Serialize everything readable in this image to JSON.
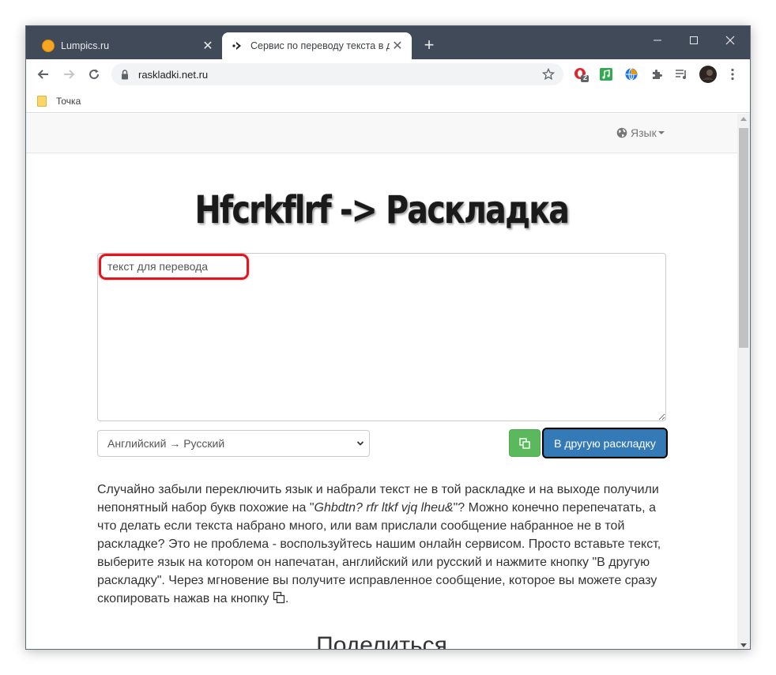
{
  "browser": {
    "tabs": [
      {
        "title": "Lumpics.ru",
        "active": false,
        "favicon": "orange-circle-icon"
      },
      {
        "title": "Сервис по переводу текста в др",
        "active": true,
        "favicon": "arrow-logo-icon"
      }
    ],
    "new_tab_label": "+",
    "address": {
      "url": "raskladki.net.ru"
    },
    "extension_badge": "2",
    "bookmarks": [
      {
        "label": "Точка",
        "icon": "folder-icon"
      }
    ]
  },
  "page": {
    "nav": {
      "language_label": "Язык"
    },
    "title": "Hfcrkflrf -> Раскладка",
    "textarea": {
      "value": "текст для перевода"
    },
    "direction_select": {
      "selected": "Английский → Русский"
    },
    "convert_button": "В другую раскладку",
    "description": {
      "p1": "Случайно забыли переключить язык и набрали текст не в той раскладке и на выходе получили непонятный набор букв похожие на \"",
      "example": "Ghbdtn? rfr ltkf vjq lheu&",
      "p2": "\"? Можно конечно перепечатать, а что делать если текста набрано много, или вам прислали сообщение набранное не в той раскладке? Это не проблема - воспользуйтесь нашим онлайн сервисом. Просто вставьте текст, выберите язык на котором он напечатан, английский или русский и нажмите кнопку \"В другую раскладку\". Через мгновение вы получите исправленное сообщение, которое вы можете сразу скопировать нажав на кнопку ",
      "p3": "."
    },
    "share_heading": "Поделиться"
  },
  "colors": {
    "tabstrip": "#414a58",
    "primary_button": "#337ab7",
    "success_button": "#5cb85c",
    "highlight": "#e2161f"
  }
}
